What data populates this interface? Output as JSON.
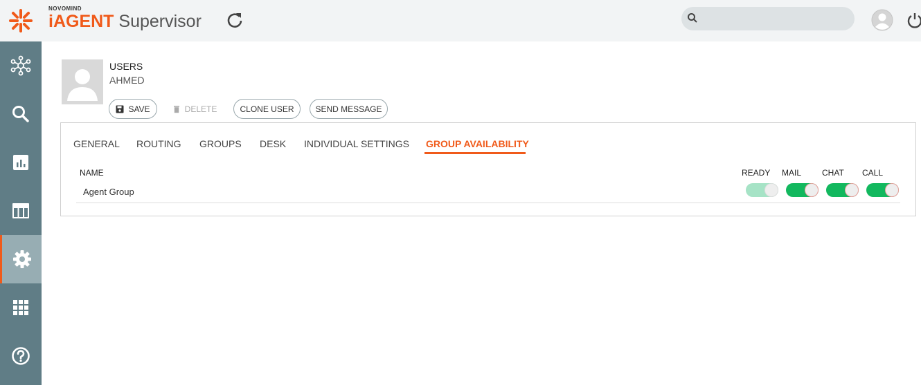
{
  "header": {
    "brand_small": "NOVOMIND",
    "brand_primary": "iAGENT",
    "brand_secondary": " Supervisor",
    "search_value": "",
    "accent_color": "#f05a1a"
  },
  "sidebar": {
    "items": [
      {
        "icon": "network-icon"
      },
      {
        "icon": "search-icon"
      },
      {
        "icon": "report-chart-icon"
      },
      {
        "icon": "table-layout-icon"
      },
      {
        "icon": "gear-icon",
        "active": true
      },
      {
        "icon": "grid-apps-icon"
      },
      {
        "icon": "help-icon"
      }
    ]
  },
  "page": {
    "breadcrumb": "USERS",
    "user_name": "AHMED"
  },
  "actions": {
    "save": "SAVE",
    "delete": "DELETE",
    "clone": "CLONE USER",
    "send_message": "SEND MESSAGE"
  },
  "tabs": [
    {
      "label": "GENERAL"
    },
    {
      "label": "ROUTING"
    },
    {
      "label": "GROUPS"
    },
    {
      "label": "DESK"
    },
    {
      "label": "INDIVIDUAL SETTINGS"
    },
    {
      "label": "GROUP AVAILABILITY",
      "active": true
    }
  ],
  "table": {
    "columns": {
      "name": "NAME",
      "ready": "READY",
      "mail": "MAIL",
      "chat": "CHAT",
      "call": "CALL"
    },
    "rows": [
      {
        "name": "Agent Group",
        "ready": "on-disabled",
        "mail": "on",
        "chat": "on",
        "call": "on"
      }
    ]
  }
}
